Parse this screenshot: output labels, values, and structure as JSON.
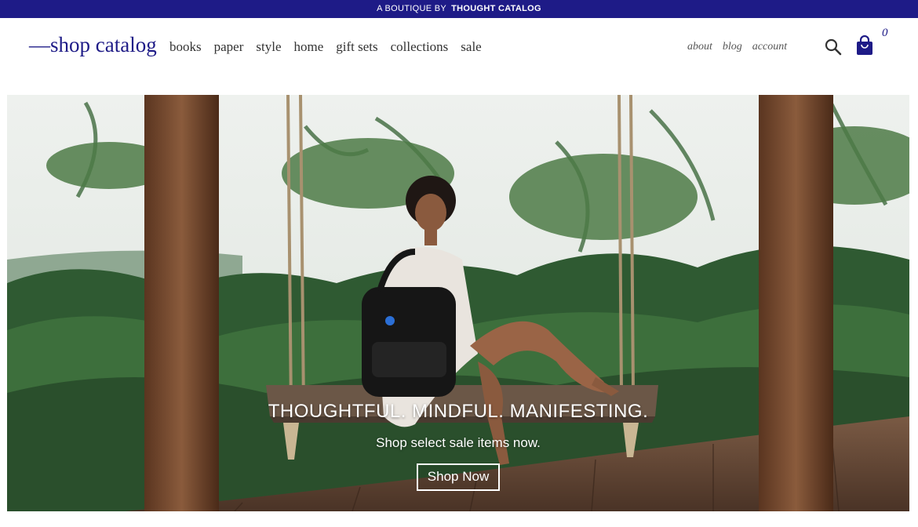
{
  "topbar": {
    "prefix": "A BOUTIQUE BY",
    "brand": "THOUGHT CATALOG"
  },
  "header": {
    "logo": "—shop catalog",
    "nav": [
      "books",
      "paper",
      "style",
      "home",
      "gift sets",
      "collections",
      "sale"
    ],
    "secondary": [
      "about",
      "blog",
      "account"
    ],
    "cart_count": "0",
    "icons": [
      "search-icon",
      "shopping-bag-icon"
    ]
  },
  "hero": {
    "headline": "THOUGHTFUL. MINDFUL. MANIFESTING.",
    "subline": "Shop select sale items now.",
    "cta": "Shop Now"
  },
  "colors": {
    "brand": "#1e1b87",
    "nav_text": "#333333",
    "hero_text": "#ffffff"
  }
}
